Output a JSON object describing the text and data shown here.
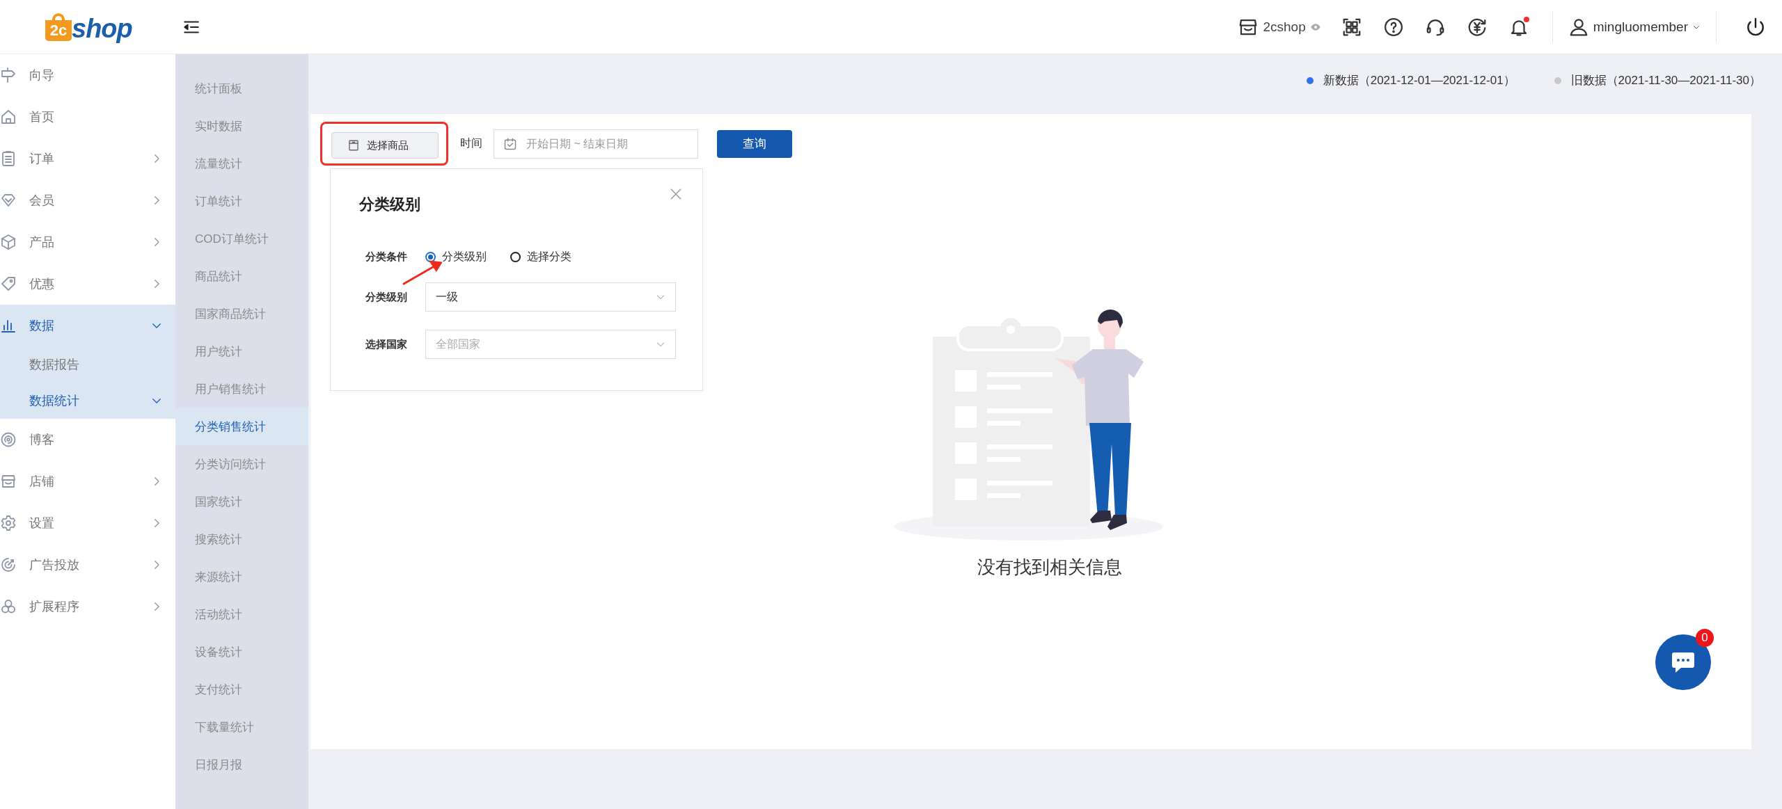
{
  "header": {
    "logo": {
      "mark": "2c",
      "text": "shop"
    },
    "store": {
      "name": "2cshop"
    },
    "notifications": {
      "unread": true
    },
    "user": {
      "name": "mingluomember"
    }
  },
  "sidebar": {
    "items": [
      {
        "label": "向导",
        "expandable": false,
        "selected": false
      },
      {
        "label": "首页",
        "expandable": false,
        "selected": false
      },
      {
        "label": "订单",
        "expandable": true,
        "expanded": false,
        "selected": false
      },
      {
        "label": "会员",
        "expandable": true,
        "expanded": false,
        "selected": false
      },
      {
        "label": "产品",
        "expandable": true,
        "expanded": false,
        "selected": false
      },
      {
        "label": "优惠",
        "expandable": true,
        "expanded": false,
        "selected": false
      },
      {
        "label": "数据",
        "expandable": true,
        "expanded": true,
        "selected": true,
        "children": [
          {
            "label": "数据报告",
            "expandable": false,
            "selected": false
          },
          {
            "label": "数据统计",
            "expandable": true,
            "expanded": true,
            "selected": true,
            "children": [
              {
                "label": "统计面板",
                "selected": false
              },
              {
                "label": "实时数据",
                "selected": false
              },
              {
                "label": "流量统计",
                "selected": false
              },
              {
                "label": "订单统计",
                "selected": false
              },
              {
                "label": "COD订单统计",
                "selected": false
              },
              {
                "label": "商品统计",
                "selected": false
              },
              {
                "label": "国家商品统计",
                "selected": false
              },
              {
                "label": "用户统计",
                "selected": false
              },
              {
                "label": "用户销售统计",
                "selected": false
              },
              {
                "label": "分类销售统计",
                "selected": true
              },
              {
                "label": "分类访问统计",
                "selected": false
              },
              {
                "label": "国家统计",
                "selected": false
              },
              {
                "label": "搜索统计",
                "selected": false
              },
              {
                "label": "来源统计",
                "selected": false
              },
              {
                "label": "活动统计",
                "selected": false
              },
              {
                "label": "设备统计",
                "selected": false
              },
              {
                "label": "支付统计",
                "selected": false
              },
              {
                "label": "下载量统计",
                "selected": false
              },
              {
                "label": "日报月报",
                "selected": false
              }
            ]
          }
        ]
      },
      {
        "label": "博客",
        "expandable": false,
        "selected": false
      },
      {
        "label": "店铺",
        "expandable": true,
        "expanded": false,
        "selected": false
      },
      {
        "label": "设置",
        "expandable": true,
        "expanded": false,
        "selected": false
      },
      {
        "label": "广告投放",
        "expandable": true,
        "expanded": false,
        "selected": false
      },
      {
        "label": "扩展程序",
        "expandable": true,
        "expanded": false,
        "selected": false
      }
    ]
  },
  "legend": [
    {
      "label": "新数据（2021-12-01—2021-12-01）",
      "color": "#2f6ff0"
    },
    {
      "label": "旧数据（2021-11-30—2021-11-30）",
      "color": "#c8c8c8"
    }
  ],
  "toolbar": {
    "product_button": {
      "label": "选择商品",
      "highlighted": true
    },
    "time_label": "时间",
    "date_field": {
      "placeholder": "开始日期 ~ 结束日期"
    },
    "query_button": "查询"
  },
  "popup": {
    "title": "分类级别",
    "rows": [
      {
        "kind": "radio",
        "label": "分类条件",
        "options": [
          {
            "label": "分类级别",
            "selected": true,
            "pointed": true
          },
          {
            "label": "选择分类",
            "selected": false,
            "pointed": false
          }
        ]
      },
      {
        "kind": "select",
        "label": "分类级别",
        "value": "一级"
      },
      {
        "kind": "select",
        "label": "选择国家",
        "placeholder": "全部国家"
      }
    ]
  },
  "empty_state": {
    "message": "没有找到相关信息"
  },
  "chat": {
    "badge": "0"
  }
}
